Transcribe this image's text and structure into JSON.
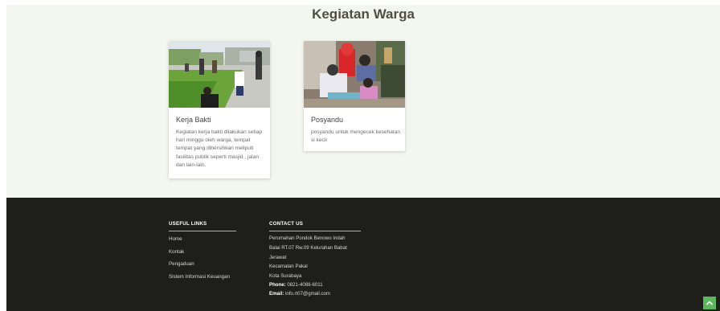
{
  "section": {
    "title": "Kegiatan Warga"
  },
  "cards": [
    {
      "title": "Kerja Bakti",
      "description": "Kegiatan kerja bakti dilakukan setiap hari minggu oleh warga, tempat tempat yang dibersihkan meliputi fasilitas publik seperti masjid , jalan dan lain-lain.",
      "image_alt": "Warga kerja bakti"
    },
    {
      "title": "Posyandu",
      "description": "posyandu untuk mengecek kesehatan si kecil",
      "image_alt": "Kegiatan posyandu"
    }
  ],
  "footer": {
    "useful_links": {
      "heading": "USEFUL LINKS",
      "items": [
        "Home",
        "Kontak",
        "Pengaduan",
        "Sistem Informasi Keuangan"
      ]
    },
    "contact": {
      "heading": "CONTACT US",
      "address_lines": [
        "Perumahan Pondok Benowo Indah",
        "Balai RT.07 Rw.09 Kelurahan Babat",
        "Jerawat",
        "Kecamatan Pakal",
        "Kota Surabaya"
      ],
      "phone_label": "Phone:",
      "phone": "0821-4088-6011",
      "email_label": "Email:",
      "email": "info.rt07@gmail.com"
    }
  },
  "colors": {
    "accent": "#b7c24e",
    "footer_bg": "#1e1e1a",
    "scroll_button": "#5cb85c"
  },
  "icons": {
    "scroll_top": "chevron-up-icon"
  }
}
